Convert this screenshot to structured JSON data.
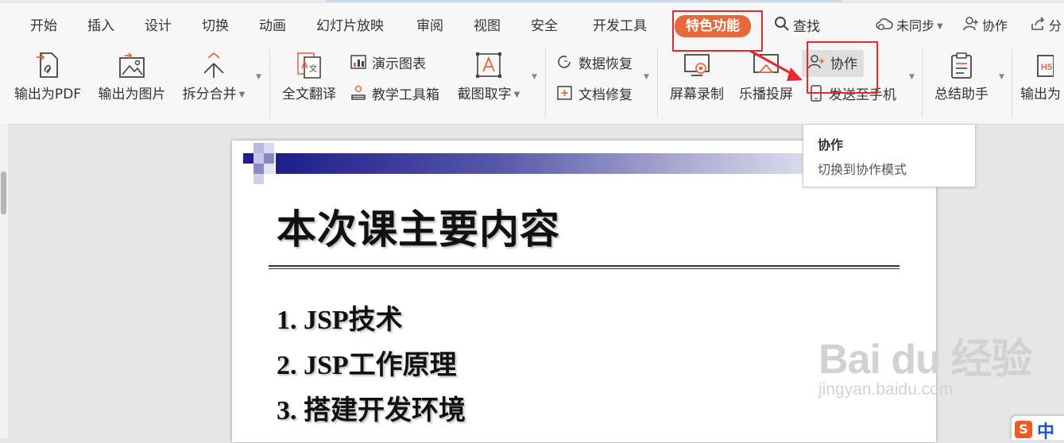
{
  "menu": {
    "tabs": [
      "开始",
      "插入",
      "设计",
      "切换",
      "动画",
      "幻灯片放映",
      "审阅",
      "视图",
      "安全",
      "开发工具"
    ],
    "active_tab": "特色功能",
    "search": "查找",
    "sync": "未同步",
    "collab": "协作",
    "share": "分"
  },
  "tools": {
    "export_pdf": "输出为PDF",
    "export_image": "输出为图片",
    "split_merge": "拆分合并",
    "translate": "全文翻译",
    "demo_chart": "演示图表",
    "teach_tools": "教学工具箱",
    "screenshot_ocr": "截图取字",
    "data_recovery": "数据恢复",
    "doc_repair": "文档修复",
    "screen_record": "屏幕录制",
    "cast": "乐播投屏",
    "collab_btn": "协作",
    "send_phone": "发送至手机",
    "summary": "总结助手",
    "export_h5": "输出为"
  },
  "tooltip": {
    "title": "协作",
    "desc": "切换到协作模式"
  },
  "slide": {
    "title": "本次课主要内容",
    "bullets": [
      "1. JSP技术",
      "2. JSP工作原理",
      "3. 搭建开发环境"
    ]
  },
  "watermark": {
    "brand": "Bai du 经验",
    "url": "jingyan.baidu.com"
  },
  "ime": {
    "label": "中"
  },
  "colors": {
    "accent": "#e5693c",
    "annotation_red": "#e8292b",
    "slide_band": "#1e1e8c"
  }
}
